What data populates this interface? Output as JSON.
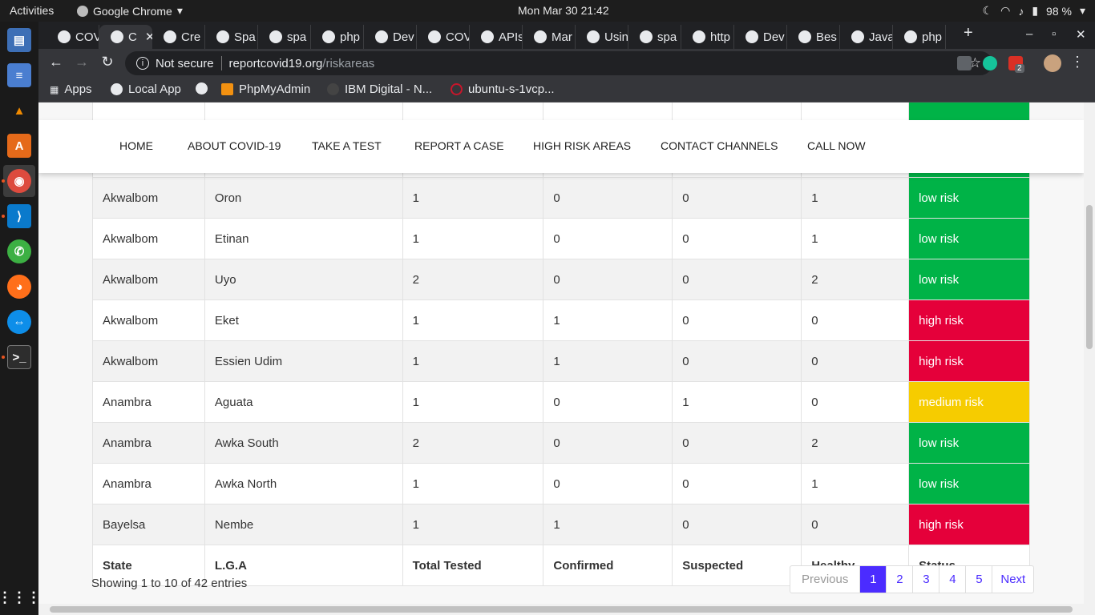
{
  "topbar": {
    "activities": "Activities",
    "app_name": "Google Chrome",
    "clock": "Mon Mar 30  21:42",
    "battery": "98 %"
  },
  "tabs": [
    {
      "label": "COV"
    },
    {
      "label": "C"
    },
    {
      "label": "Cre"
    },
    {
      "label": "Spa"
    },
    {
      "label": "spa"
    },
    {
      "label": "php"
    },
    {
      "label": "Dev"
    },
    {
      "label": "COV"
    },
    {
      "label": "APIs"
    },
    {
      "label": "Mar"
    },
    {
      "label": "Usin"
    },
    {
      "label": "spa"
    },
    {
      "label": "http"
    },
    {
      "label": "Dev"
    },
    {
      "label": "Bes"
    },
    {
      "label": "Java"
    },
    {
      "label": "php"
    }
  ],
  "omnibox": {
    "security": "Not secure",
    "host": "reportcovid19.org",
    "path": "/riskareas"
  },
  "bookmarks": [
    {
      "label": "Apps"
    },
    {
      "label": "Local App"
    },
    {
      "label": ""
    },
    {
      "label": "PhpMyAdmin"
    },
    {
      "label": "IBM Digital - N..."
    },
    {
      "label": "ubuntu-s-1vcp..."
    }
  ],
  "extensions": {
    "badge": "2"
  },
  "nav": [
    "HOME",
    "ABOUT COVID-19",
    "TAKE A TEST",
    "REPORT A CASE",
    "HIGH RISK AREAS",
    "CONTACT CHANNELS",
    "CALL NOW"
  ],
  "table": {
    "headers": [
      "State",
      "L.G.A",
      "Total Tested",
      "Confirmed",
      "Suspected",
      "Healthy",
      "Status"
    ],
    "rows": [
      [
        "Akwalbom",
        "Oron",
        "1",
        "0",
        "0",
        "1",
        "low risk"
      ],
      [
        "Akwalbom",
        "Etinan",
        "1",
        "0",
        "0",
        "1",
        "low risk"
      ],
      [
        "Akwalbom",
        "Uyo",
        "2",
        "0",
        "0",
        "2",
        "low risk"
      ],
      [
        "Akwalbom",
        "Eket",
        "1",
        "1",
        "0",
        "0",
        "high risk"
      ],
      [
        "Akwalbom",
        "Essien Udim",
        "1",
        "1",
        "0",
        "0",
        "high risk"
      ],
      [
        "Anambra",
        "Aguata",
        "1",
        "0",
        "1",
        "0",
        "medium risk"
      ],
      [
        "Anambra",
        "Awka South",
        "2",
        "0",
        "0",
        "2",
        "low risk"
      ],
      [
        "Anambra",
        "Awka North",
        "1",
        "0",
        "0",
        "1",
        "low risk"
      ],
      [
        "Bayelsa",
        "Nembe",
        "1",
        "1",
        "0",
        "0",
        "high risk"
      ]
    ]
  },
  "info": "Showing 1 to 10 of 42 entries",
  "pagination": {
    "previous": "Previous",
    "pages": [
      "1",
      "2",
      "3",
      "4",
      "5"
    ],
    "next": "Next",
    "active": "1"
  },
  "colors": {
    "low": "#00b347",
    "high": "#e5003a",
    "medium": "#f6cc00",
    "accent": "#4b2cff"
  }
}
